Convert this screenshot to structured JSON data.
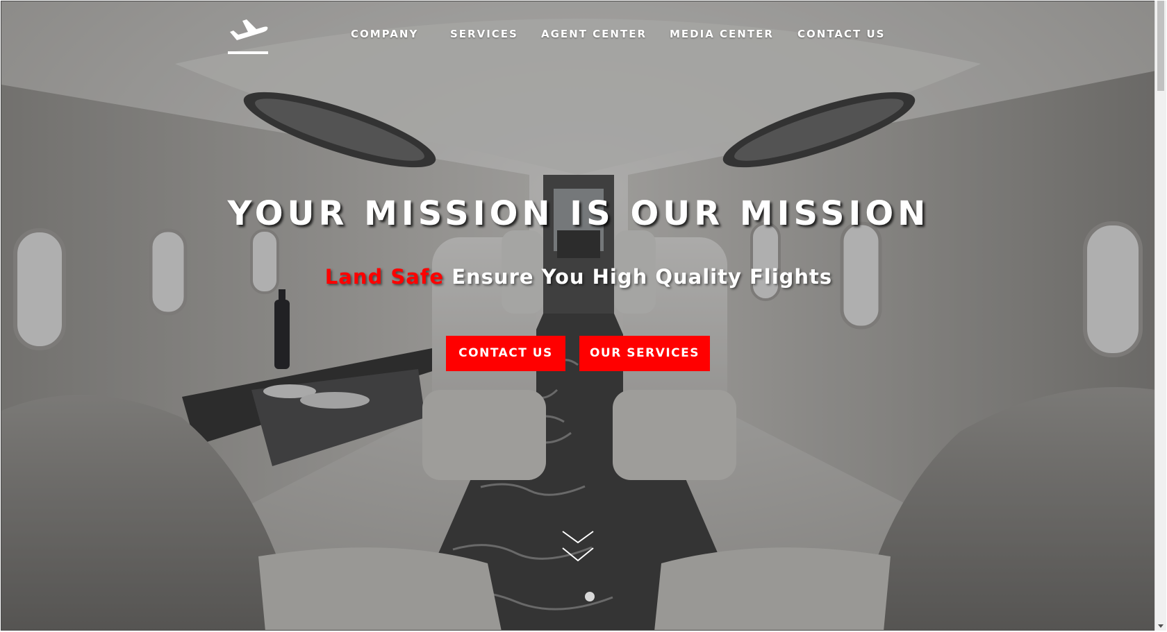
{
  "nav": {
    "logo_icon": "airplane-takeoff-icon",
    "items": [
      {
        "label": "COMPANY"
      },
      {
        "label": "SERVICES"
      },
      {
        "label": "AGENT CENTER"
      },
      {
        "label": "MEDIA CENTER"
      },
      {
        "label": "CONTACT US"
      }
    ]
  },
  "hero": {
    "headline": "YOUR MISSION IS OUR MISSION",
    "brand": "Land Safe",
    "tagline": "Ensure You High Quality Flights",
    "buttons": {
      "contact": "CONTACT US",
      "services": "OUR SERVICES"
    },
    "scroll_icon": "double-chevron-down-icon",
    "slides_total": 1,
    "active_slide": 1
  },
  "colors": {
    "accent": "#ff0000",
    "text": "#ffffff"
  }
}
